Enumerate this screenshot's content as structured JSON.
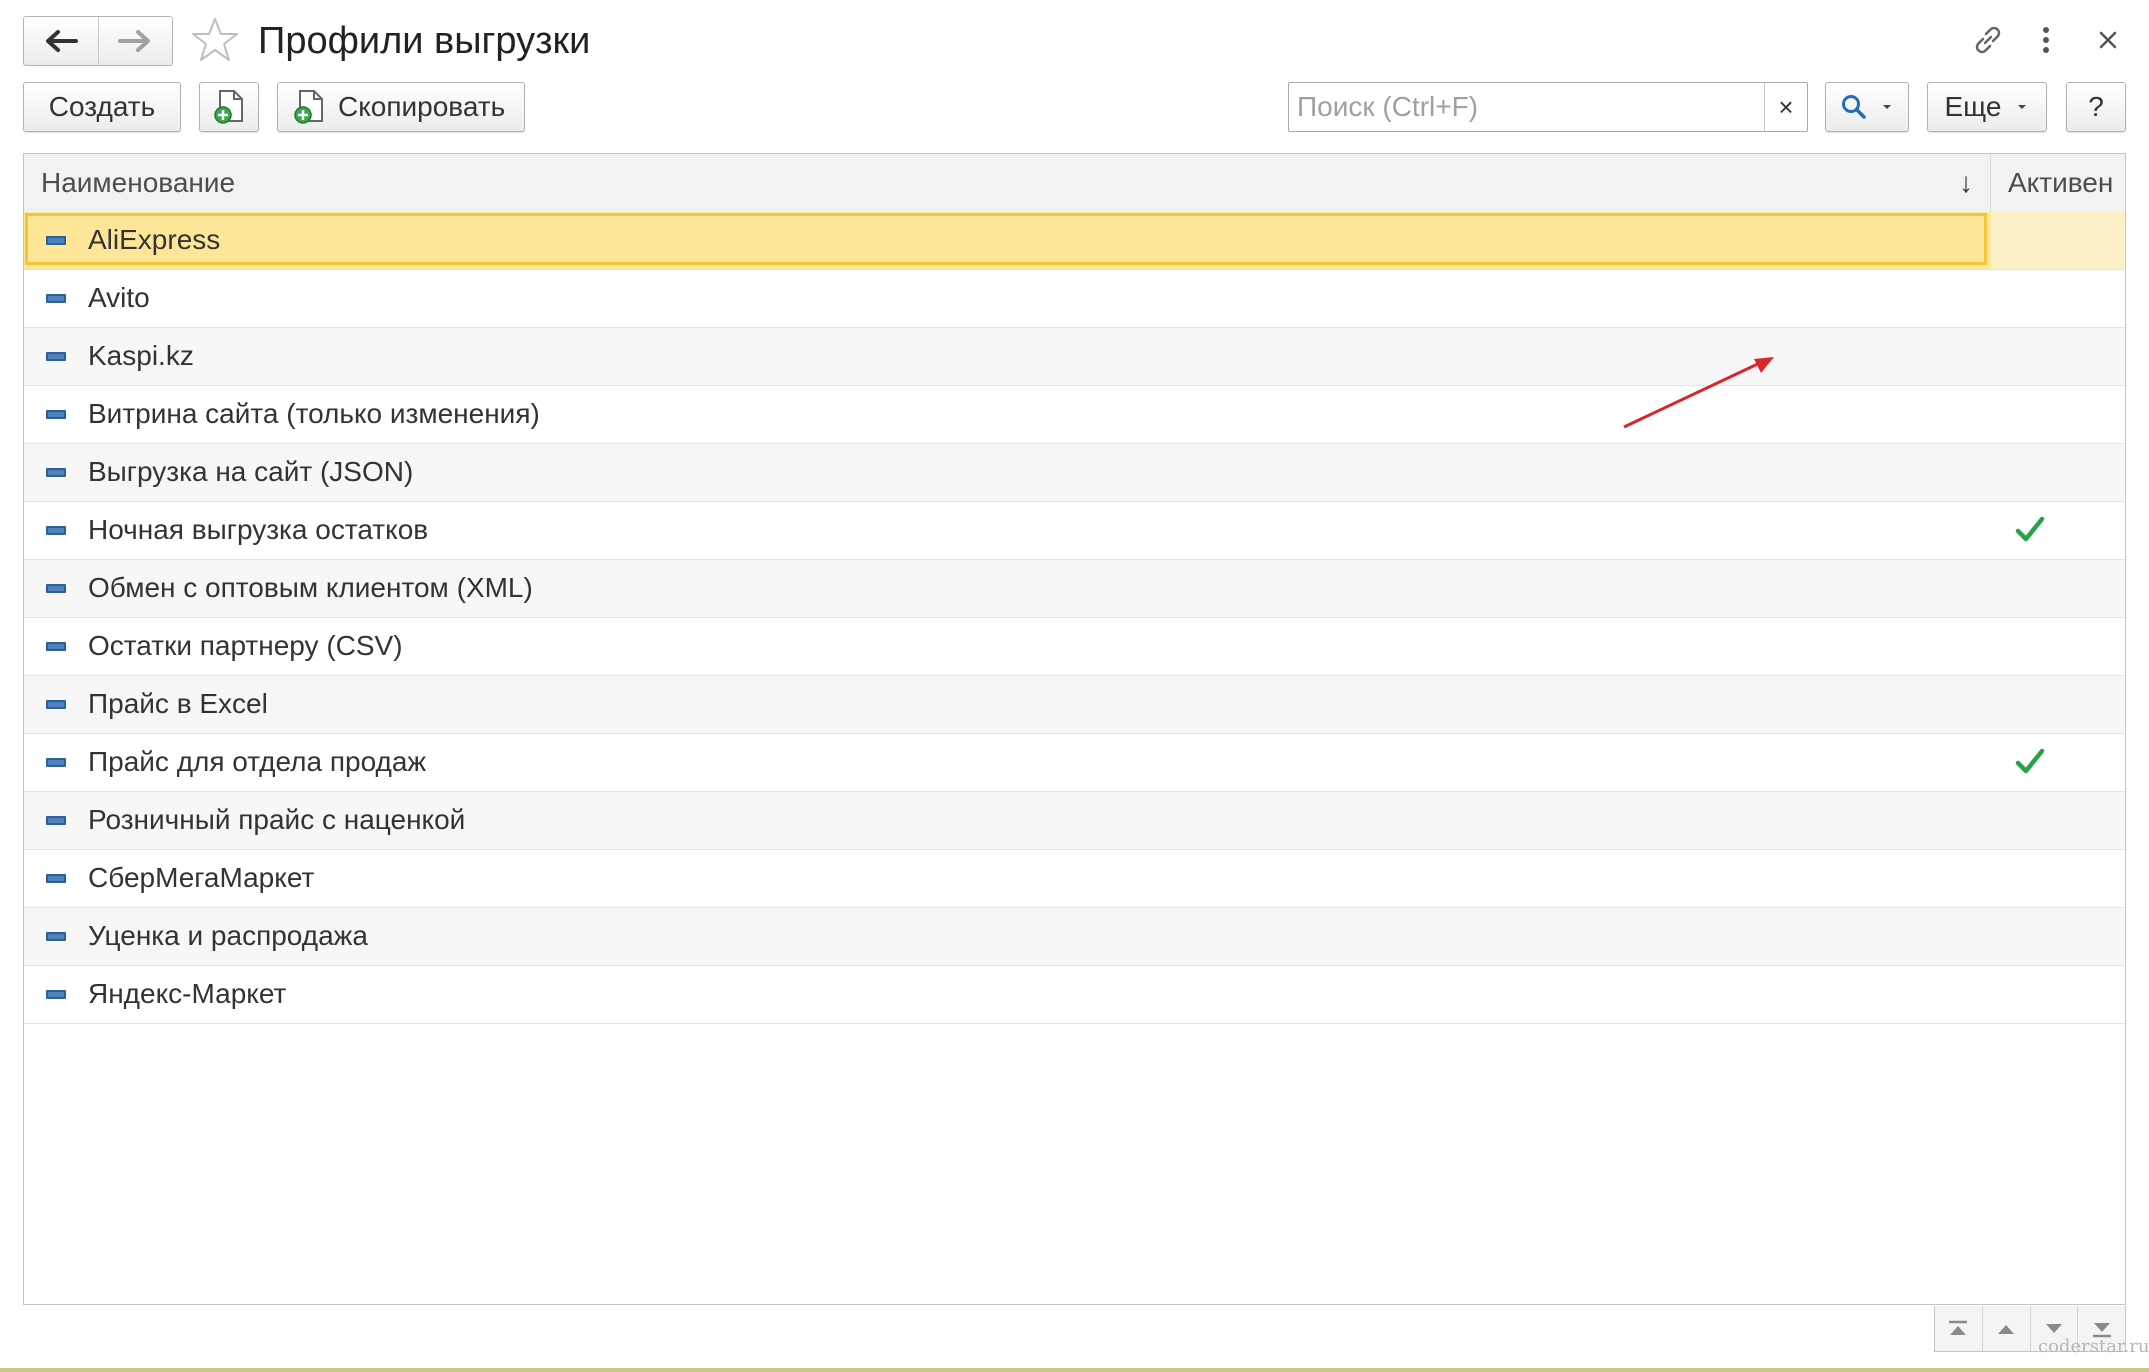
{
  "window": {
    "title": "Профили выгрузки",
    "icons": [
      "back-arrow-icon",
      "forward-arrow-icon",
      "star-icon",
      "link-icon",
      "more-vertical-icon",
      "close-icon"
    ]
  },
  "toolbar": {
    "create_label": "Создать",
    "copy_label": "Скопировать",
    "search_placeholder": "Поиск (Ctrl+F)",
    "clear_label": "×",
    "more_label": "Еще",
    "help_label": "?"
  },
  "grid": {
    "columns": {
      "name": "Наименование",
      "sort_indicator": "↓",
      "active": "Активен"
    },
    "rows": [
      {
        "name": "AliExpress",
        "active": false,
        "selected": true
      },
      {
        "name": "Avito",
        "active": false
      },
      {
        "name": "Kaspi.kz",
        "active": false
      },
      {
        "name": "Витрина сайта (только изменения)",
        "active": false
      },
      {
        "name": "Выгрузка на сайт (JSON)",
        "active": false
      },
      {
        "name": "Ночная выгрузка остатков",
        "active": true
      },
      {
        "name": "Обмен с оптовым клиентом (XML)",
        "active": false
      },
      {
        "name": "Остатки партнеру (CSV)",
        "active": false
      },
      {
        "name": "Прайс в Excel",
        "active": false
      },
      {
        "name": "Прайс для отдела продаж",
        "active": true
      },
      {
        "name": "Розничный прайс с наценкой",
        "active": false
      },
      {
        "name": "СберМегаМаркет",
        "active": false
      },
      {
        "name": "Уценка и распродажа",
        "active": false
      },
      {
        "name": "Яндекс-Маркет",
        "active": false
      }
    ]
  },
  "colors": {
    "selection_fill": "#fde698",
    "selection_border": "#f3c53a",
    "check_green": "#2aa147",
    "annotation_arrow": "#d9262b",
    "row_icon": "#4f81bd"
  },
  "watermark": "coderstar.ru"
}
